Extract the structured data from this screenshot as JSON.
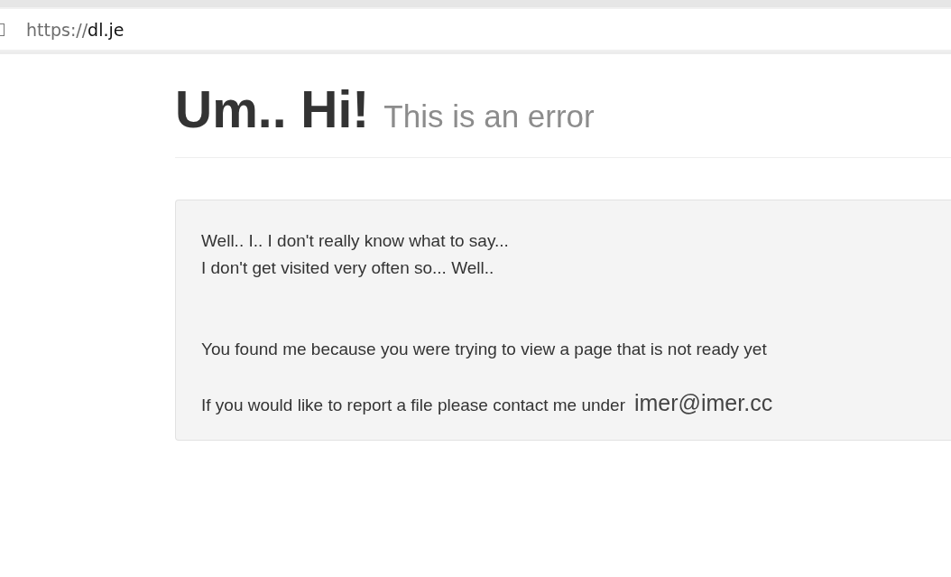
{
  "address_bar": {
    "scheme": "https://",
    "host": "dl.je"
  },
  "heading": {
    "title": "Um.. Hi!",
    "subtitle": "This is an error"
  },
  "message": {
    "lines": [
      "Well.. I.. I don't really know what to say...",
      "I don't get visited very often so... Well.."
    ],
    "reason": "You found me because you were trying to view a page that is not ready yet",
    "contact_text": "If you would like to report a file please contact me under",
    "email": "imer@imer.cc"
  }
}
